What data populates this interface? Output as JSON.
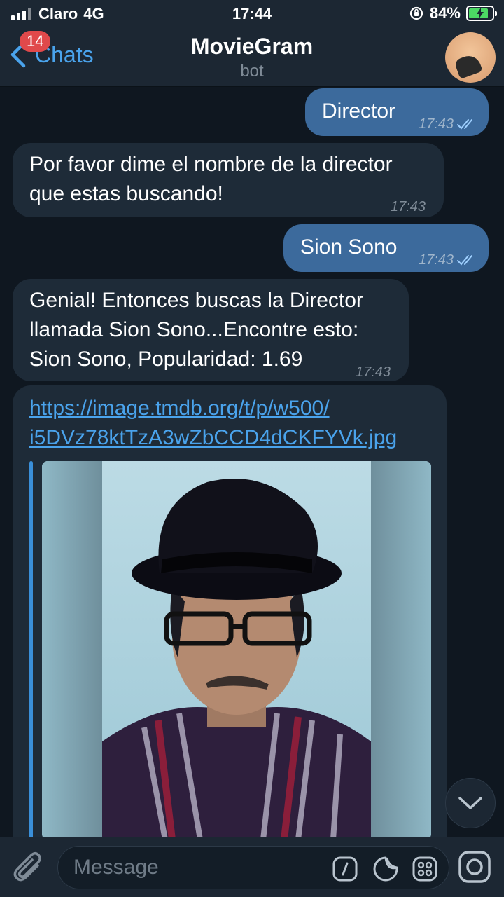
{
  "status": {
    "carrier": "Claro",
    "network": "4G",
    "time": "17:44",
    "battery": "84%",
    "battery_level": 0.84
  },
  "header": {
    "back_label": "Chats",
    "unread_badge": "14",
    "title": "MovieGram",
    "subtitle": "bot"
  },
  "messages": [
    {
      "dir": "out",
      "text": "Director",
      "time": "17:43"
    },
    {
      "dir": "in",
      "lines": [
        "Por favor dime el nombre de la director",
        "que estas buscando!"
      ],
      "time": "17:43"
    },
    {
      "dir": "out",
      "text": "Sion Sono",
      "time": "17:43"
    },
    {
      "dir": "in",
      "lines": [
        "Genial! Entonces buscas la Director",
        "llamada Sion Sono...Encontre esto:",
        "Sion Sono, Popularidad: 1.69"
      ],
      "time": "17:43"
    },
    {
      "dir": "in",
      "link_lines": [
        "https://image.tmdb.org/t/p/w500/",
        "i5DVz78ktTzA3wZbCCD4dCKFYVk.jpg"
      ]
    }
  ],
  "composer": {
    "placeholder": "Message"
  },
  "icons": {
    "back": "chevron-left-icon",
    "attach": "paperclip-icon",
    "commands": "slash-command-icon",
    "sticker": "sticker-icon",
    "bot_menu": "grid-icon",
    "camera": "camera-icon",
    "scroll": "chevron-down-icon"
  },
  "colors": {
    "background": "#0f1720",
    "bar": "#1c2733",
    "outgoing": "#3c6a9c",
    "incoming": "#1e2b38",
    "accent": "#4aa3ec",
    "badge": "#e0494b"
  }
}
